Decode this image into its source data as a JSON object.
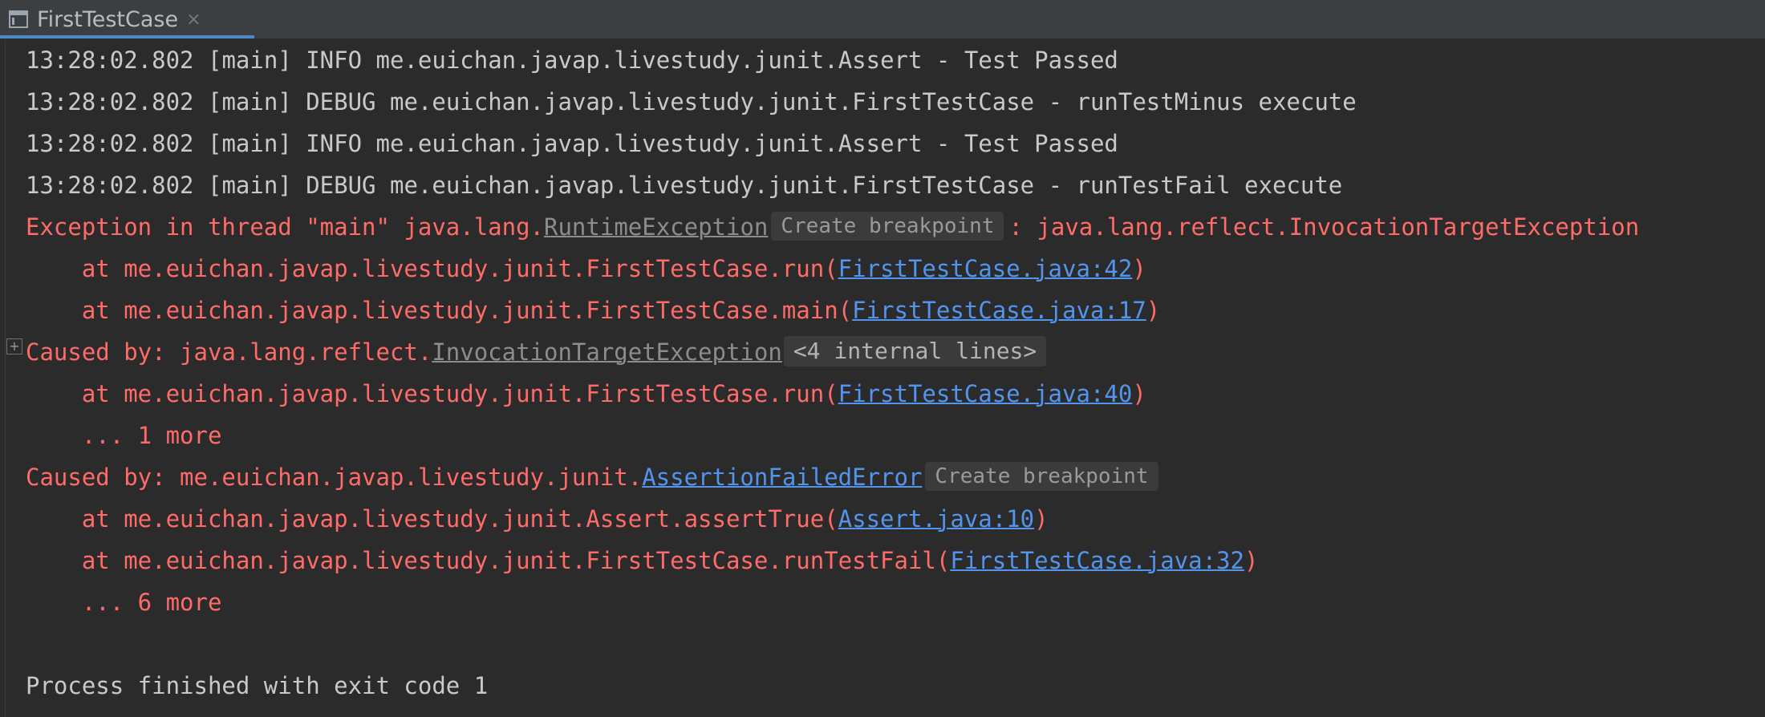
{
  "tab": {
    "title": "FirstTestCase",
    "close_glyph": "×",
    "icon": "console-icon"
  },
  "console": {
    "lines": [
      {
        "time": "13:28:02.802",
        "thread": "[main]",
        "level": "INFO",
        "text": "me.euichan.javap.livestudy.junit.Assert - Test Passed"
      },
      {
        "time": "13:28:02.802",
        "thread": "[main]",
        "level": "DEBUG",
        "text": "me.euichan.javap.livestudy.junit.FirstTestCase - runTestMinus execute"
      },
      {
        "time": "13:28:02.802",
        "thread": "[main]",
        "level": "INFO",
        "text": "me.euichan.javap.livestudy.junit.Assert - Test Passed"
      },
      {
        "time": "13:28:02.802",
        "thread": "[main]",
        "level": "DEBUG",
        "text": "me.euichan.javap.livestudy.junit.FirstTestCase - runTestFail execute"
      }
    ],
    "exception": {
      "prefix": "Exception in thread \"main\" java.lang.",
      "class_link": "RuntimeException",
      "hint": "Create breakpoint",
      "suffix": ": java.lang.reflect.InvocationTargetException",
      "frames": [
        {
          "prefix": "    at me.euichan.javap.livestudy.junit.FirstTestCase.run(",
          "link": "FirstTestCase.java:42",
          "suffix": ")"
        },
        {
          "prefix": "    at me.euichan.javap.livestudy.junit.FirstTestCase.main(",
          "link": "FirstTestCase.java:17",
          "suffix": ")"
        }
      ]
    },
    "cause1": {
      "expand_glyph": "+",
      "prefix": "Caused by: java.lang.reflect.",
      "class_link": "InvocationTargetException",
      "fold": "<4 internal lines>",
      "frames": [
        {
          "prefix": "    at me.euichan.javap.livestudy.junit.FirstTestCase.run(",
          "link": "FirstTestCase.java:40",
          "suffix": ")"
        }
      ],
      "more": "    ... 1 more"
    },
    "cause2": {
      "prefix": "Caused by: me.euichan.javap.livestudy.junit.",
      "class_link": "AssertionFailedError",
      "hint": "Create breakpoint",
      "frames": [
        {
          "prefix": "    at me.euichan.javap.livestudy.junit.Assert.assertTrue(",
          "link": "Assert.java:10",
          "suffix": ")"
        },
        {
          "prefix": "    at me.euichan.javap.livestudy.junit.FirstTestCase.runTestFail(",
          "link": "FirstTestCase.java:32",
          "suffix": ")"
        }
      ],
      "more": "    ... 6 more"
    },
    "exit_message": "Process finished with exit code 1"
  },
  "colors": {
    "background": "#2b2b2b",
    "error_red": "#ff6b68",
    "link_blue": "#5394ec",
    "text_grey": "#c9c9c9"
  }
}
